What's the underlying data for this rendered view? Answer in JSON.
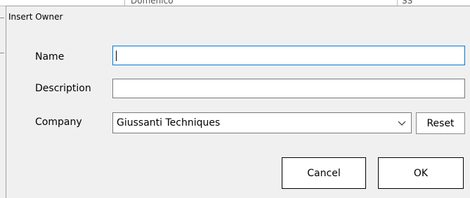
{
  "background_window": {
    "column_1_header": "Domenico",
    "column_2_header": "SS"
  },
  "dialog": {
    "title": "Insert Owner",
    "fields": {
      "name_label": "Name",
      "name_value": "",
      "description_label": "Description",
      "description_value": "",
      "company_label": "Company",
      "company_value": "Giussanti Techniques"
    },
    "buttons": {
      "reset": "Reset",
      "cancel": "Cancel",
      "ok": "OK"
    }
  },
  "icons": {
    "dropdown": "chevron-down-icon"
  },
  "colors": {
    "focus_border": "#0078d7",
    "dialog_background": "#f0f0f0"
  }
}
